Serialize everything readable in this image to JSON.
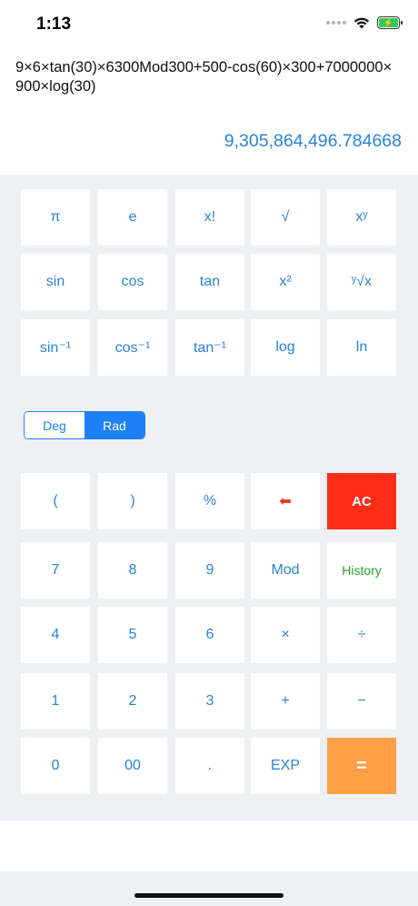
{
  "status": {
    "time": "1:13"
  },
  "display": {
    "expression": "9×6×tan(30)×6300Mod300+500-cos(60)×300+7000000×900×log(30)",
    "result": "9,305,864,496.784668"
  },
  "scientific_keys": [
    {
      "name": "pi-key",
      "label": "π"
    },
    {
      "name": "e-key",
      "label": "e"
    },
    {
      "name": "factorial-key",
      "label": "x!"
    },
    {
      "name": "sqrt-key",
      "label": "√"
    },
    {
      "name": "power-key",
      "label": "xʸ"
    },
    {
      "name": "sin-key",
      "label": "sin"
    },
    {
      "name": "cos-key",
      "label": "cos"
    },
    {
      "name": "tan-key",
      "label": "tan"
    },
    {
      "name": "square-key",
      "label": "x²"
    },
    {
      "name": "yroot-key",
      "label": "ʸ√x"
    },
    {
      "name": "asin-key",
      "label": "sin⁻¹"
    },
    {
      "name": "acos-key",
      "label": "cos⁻¹"
    },
    {
      "name": "atan-key",
      "label": "tan⁻¹"
    },
    {
      "name": "log-key",
      "label": "log"
    },
    {
      "name": "ln-key",
      "label": "ln"
    }
  ],
  "angle_mode": {
    "options": [
      "Deg",
      "Rad"
    ],
    "selected": "Rad"
  },
  "main_keys": [
    {
      "name": "open-paren-key",
      "label": "("
    },
    {
      "name": "close-paren-key",
      "label": ")"
    },
    {
      "name": "percent-key",
      "label": "%"
    },
    {
      "name": "backspace-key",
      "label": "⬅",
      "icon": "backspace-arrow-icon"
    },
    {
      "name": "ac-key",
      "label": "AC"
    },
    {
      "name": "seven-key",
      "label": "7"
    },
    {
      "name": "eight-key",
      "label": "8"
    },
    {
      "name": "nine-key",
      "label": "9"
    },
    {
      "name": "mod-key",
      "label": "Mod"
    },
    {
      "name": "history-key",
      "label": "History"
    },
    {
      "name": "four-key",
      "label": "4"
    },
    {
      "name": "five-key",
      "label": "5"
    },
    {
      "name": "six-key",
      "label": "6"
    },
    {
      "name": "multiply-key",
      "label": "×"
    },
    {
      "name": "divide-key",
      "label": "÷"
    },
    {
      "name": "one-key",
      "label": "1"
    },
    {
      "name": "two-key",
      "label": "2"
    },
    {
      "name": "three-key",
      "label": "3"
    },
    {
      "name": "plus-key",
      "label": "+"
    },
    {
      "name": "minus-key",
      "label": "−"
    },
    {
      "name": "zero-key",
      "label": "0"
    },
    {
      "name": "double-zero-key",
      "label": "00"
    },
    {
      "name": "decimal-key",
      "label": "."
    },
    {
      "name": "exp-key",
      "label": "EXP"
    },
    {
      "name": "equals-key",
      "label": "="
    }
  ],
  "colors": {
    "accent": "#2a83d6",
    "ac_key": "#fd2d18",
    "equals_key": "#ff9f45",
    "history_text": "#2e9e2a",
    "segmented_blue": "#1e80f6",
    "keypad_background": "#eff0f4"
  }
}
